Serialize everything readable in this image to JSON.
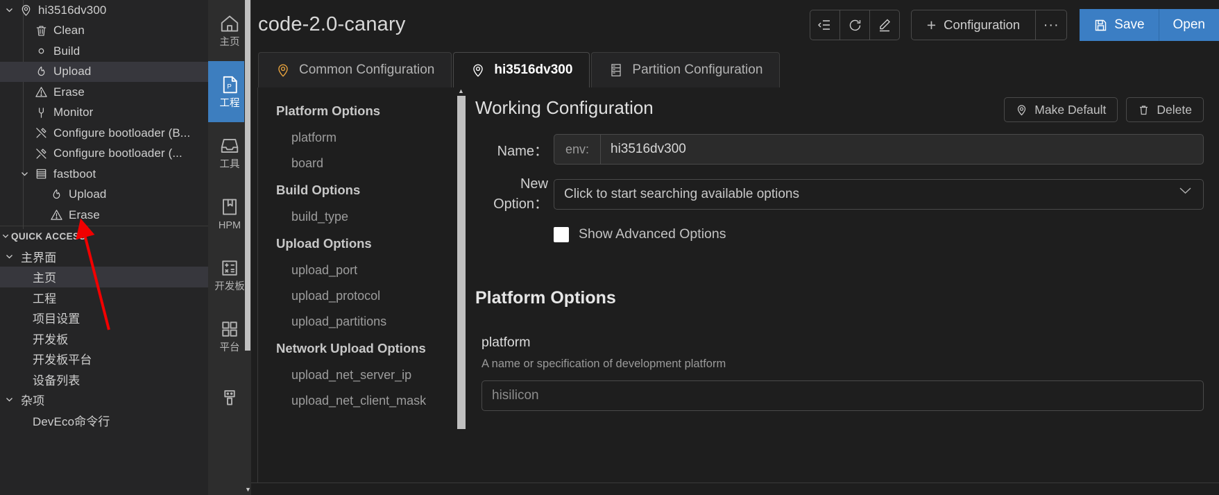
{
  "explorer": {
    "tree": [
      {
        "label": "hi3516dv300",
        "icon": "location-pin-icon",
        "indent": 0,
        "twisty": "v",
        "selected": false
      },
      {
        "label": "Clean",
        "icon": "trash-icon",
        "indent": 1,
        "twisty": "",
        "selected": false
      },
      {
        "label": "Build",
        "icon": "circle-icon",
        "indent": 1,
        "twisty": "",
        "selected": false
      },
      {
        "label": "Upload",
        "icon": "flame-icon",
        "indent": 1,
        "twisty": "",
        "selected": true
      },
      {
        "label": "Erase",
        "icon": "warning-triangle-icon",
        "indent": 1,
        "twisty": "",
        "selected": false
      },
      {
        "label": "Monitor",
        "icon": "plug-icon",
        "indent": 1,
        "twisty": "",
        "selected": false
      },
      {
        "label": "Configure bootloader (B...",
        "icon": "tools-icon",
        "indent": 1,
        "twisty": "",
        "selected": false
      },
      {
        "label": "Configure bootloader (...",
        "icon": "tools-icon",
        "indent": 1,
        "twisty": "",
        "selected": false
      },
      {
        "label": "fastboot",
        "icon": "server-icon",
        "indent": 1,
        "twisty": "v",
        "selected": false
      },
      {
        "label": "Upload",
        "icon": "flame-icon",
        "indent": 2,
        "twisty": "",
        "selected": false
      },
      {
        "label": "Erase",
        "icon": "warning-triangle-icon",
        "indent": 2,
        "twisty": "",
        "selected": false
      }
    ],
    "quick_access_title": "QUICK ACCESS",
    "groups": [
      {
        "title": "主界面",
        "items": [
          {
            "label": "主页",
            "selected": true
          },
          {
            "label": "工程",
            "selected": false
          },
          {
            "label": "项目设置",
            "selected": false
          },
          {
            "label": "开发板",
            "selected": false
          },
          {
            "label": "开发板平台",
            "selected": false
          },
          {
            "label": "设备列表",
            "selected": false
          }
        ]
      },
      {
        "title": "杂项",
        "items": [
          {
            "label": "DevEco命令行",
            "selected": false
          }
        ]
      }
    ]
  },
  "rail": {
    "items": [
      {
        "label": "主页",
        "icon": "home-icon",
        "active": false
      },
      {
        "label": "工程",
        "icon": "project-file-icon",
        "active": true
      },
      {
        "label": "工具",
        "icon": "inbox-icon",
        "active": false
      },
      {
        "label": "HPM",
        "icon": "book-icon",
        "active": false
      },
      {
        "label": "开发板",
        "icon": "calculator-icon",
        "active": false
      },
      {
        "label": "平台",
        "icon": "grid-icon",
        "active": false
      },
      {
        "label": "",
        "icon": "usb-icon",
        "active": false
      }
    ]
  },
  "header": {
    "project_title": "code-2.0-canary",
    "icon_buttons": [
      {
        "name": "collapse-all-icon"
      },
      {
        "name": "refresh-icon"
      },
      {
        "name": "edit-pencil-icon"
      }
    ],
    "configuration_label": "Configuration",
    "configuration_plus": "+",
    "more_label": "···",
    "save_label": "Save",
    "open_label": "Open"
  },
  "tabs": [
    {
      "label": "Common Configuration",
      "icon": "location-pin-icon",
      "active": false
    },
    {
      "label": "hi3516dv300",
      "icon": "location-pin-icon",
      "active": true
    },
    {
      "label": "Partition Configuration",
      "icon": "partition-icon",
      "active": false
    }
  ],
  "options_nav": [
    {
      "type": "group",
      "label": "Platform Options"
    },
    {
      "type": "item",
      "label": "platform"
    },
    {
      "type": "item",
      "label": "board"
    },
    {
      "type": "group",
      "label": "Build Options"
    },
    {
      "type": "item",
      "label": "build_type"
    },
    {
      "type": "group",
      "label": "Upload Options"
    },
    {
      "type": "item",
      "label": "upload_port"
    },
    {
      "type": "item",
      "label": "upload_protocol"
    },
    {
      "type": "item",
      "label": "upload_partitions"
    },
    {
      "type": "group",
      "label": "Network Upload Options"
    },
    {
      "type": "item",
      "label": "upload_net_server_ip"
    },
    {
      "type": "item",
      "label": "upload_net_client_mask"
    }
  ],
  "working_config": {
    "title": "Working Configuration",
    "make_default_label": "Make Default",
    "delete_label": "Delete",
    "name_label": "Name：",
    "name_prefix": "env:",
    "name_value": "hi3516dv300",
    "new_option_label": "New Option：",
    "new_option_placeholder": "Click to start searching available options",
    "show_advanced_label": "Show Advanced Options"
  },
  "platform_section": {
    "title": "Platform Options",
    "option_name": "platform",
    "option_desc": "A name or specification of development platform",
    "option_placeholder": "hisilicon"
  },
  "colors": {
    "accent_blue": "#3b7ec4",
    "selection_gray": "#37373d",
    "tab_orange": "#e8a33d",
    "annotation_red": "#f10000"
  }
}
